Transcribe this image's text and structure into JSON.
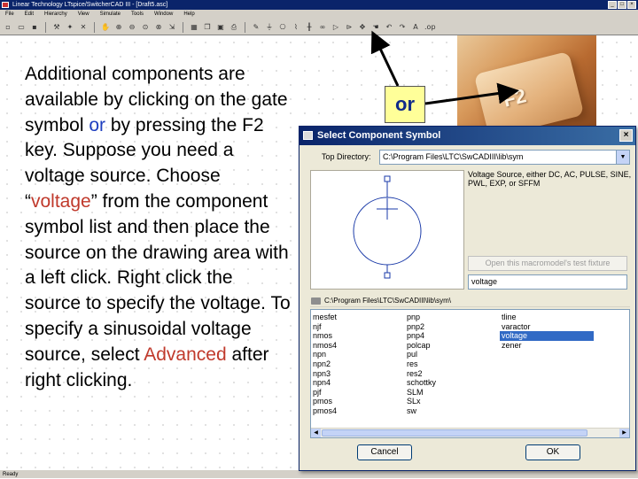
{
  "window": {
    "title": "Linear Technology LTspice/SwitcherCAD III - [Draft5.asc]",
    "menu": [
      "File",
      "Edit",
      "Hierarchy",
      "View",
      "Simulate",
      "Tools",
      "Window",
      "Help"
    ]
  },
  "toolbar": {
    "icons": [
      "new-schematic-icon",
      "open-icon",
      "save-icon",
      "control-panel-icon",
      "run-icon",
      "halt-icon",
      "pan-icon",
      "zoom-in-icon",
      "zoom-out-icon",
      "zoom-fit-icon",
      "zoom-cancel-icon",
      "autorange-icon",
      "tile-icon",
      "cascade-icon",
      "close-window-icon",
      "print-icon",
      "wire-icon",
      "ground-icon",
      "label-net-icon",
      "resistor-icon",
      "capacitor-icon",
      "inductor-icon",
      "diode-icon",
      "component-icon",
      "move-icon",
      "drag-icon",
      "undo-icon",
      "redo-icon",
      "text-icon",
      "spice-directive-icon"
    ]
  },
  "status": {
    "text": "Ready"
  },
  "instructions": {
    "t1": "Additional components are available by clicking on the gate symbol ",
    "or": "or",
    "t2": " by pressing the F2 key.  Suppose you need a voltage source.  Choose “",
    "voltage": "voltage",
    "t3": "” from the component symbol list and then place the source on the drawing area with a left click.  Right click the source to specify the voltage.  To specify a sinusoidal voltage source, select ",
    "advanced": "Advanced",
    "t4": " after right clicking."
  },
  "callout": {
    "or_text": "or",
    "key_label": "F2"
  },
  "dialog": {
    "title": "Select Component Symbol",
    "top_directory_label": "Top Directory:",
    "top_directory_value": "C:\\Program Files\\LTC\\SwCADIII\\lib\\sym",
    "description": "Voltage Source, either DC, AC, PULSE, SINE, PWL, EXP, or SFFM",
    "open_macromodel_label": "Open this macromodel's test fixture",
    "name_value": "voltage",
    "path": "C:\\Program Files\\LTC\\SwCADIII\\lib\\sym\\",
    "list_col1": [
      "mesfet",
      "njf",
      "nmos",
      "nmos4",
      "npn",
      "npn2",
      "npn3",
      "npn4",
      "pjf",
      "pmos",
      "pmos4"
    ],
    "list_col2": [
      "pnp",
      "pnp2",
      "pnp4",
      "polcap",
      "pul",
      "res",
      "res2",
      "schottky",
      "SLM",
      "SLx",
      "sw"
    ],
    "list_col3": [
      "tline",
      "varactor",
      "voltage",
      "zener"
    ],
    "selected_item": "voltage",
    "cancel_label": "Cancel",
    "ok_label": "OK",
    "colors": {
      "selection": "#316ac5",
      "symbol": "#1a3aa8"
    }
  }
}
